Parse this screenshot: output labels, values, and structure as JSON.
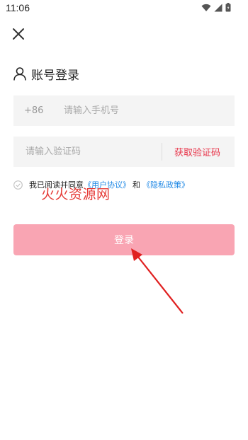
{
  "status": {
    "time": "11:06"
  },
  "title": {
    "text": "账号登录"
  },
  "phone": {
    "country_code": "+86",
    "placeholder": "请输入手机号",
    "value": ""
  },
  "code": {
    "placeholder": "请输入验证码",
    "value": "",
    "get_code_label": "获取验证码"
  },
  "agreement": {
    "prefix": "我已阅读并同意",
    "user_agreement": "《用户协议》",
    "and": "和",
    "privacy_policy": "《隐私政策》"
  },
  "watermark": {
    "text": "火火资源网"
  },
  "login": {
    "label": "登录"
  },
  "colors": {
    "accent_red": "#e8354a",
    "login_button": "#f9a5b3",
    "link_blue": "#1f88e5",
    "annotation_arrow": "#e02020"
  },
  "icons": [
    "wifi-icon",
    "signal-icon",
    "battery-icon",
    "close-icon",
    "user-icon",
    "check-circle-icon",
    "arrow-annotation"
  ]
}
